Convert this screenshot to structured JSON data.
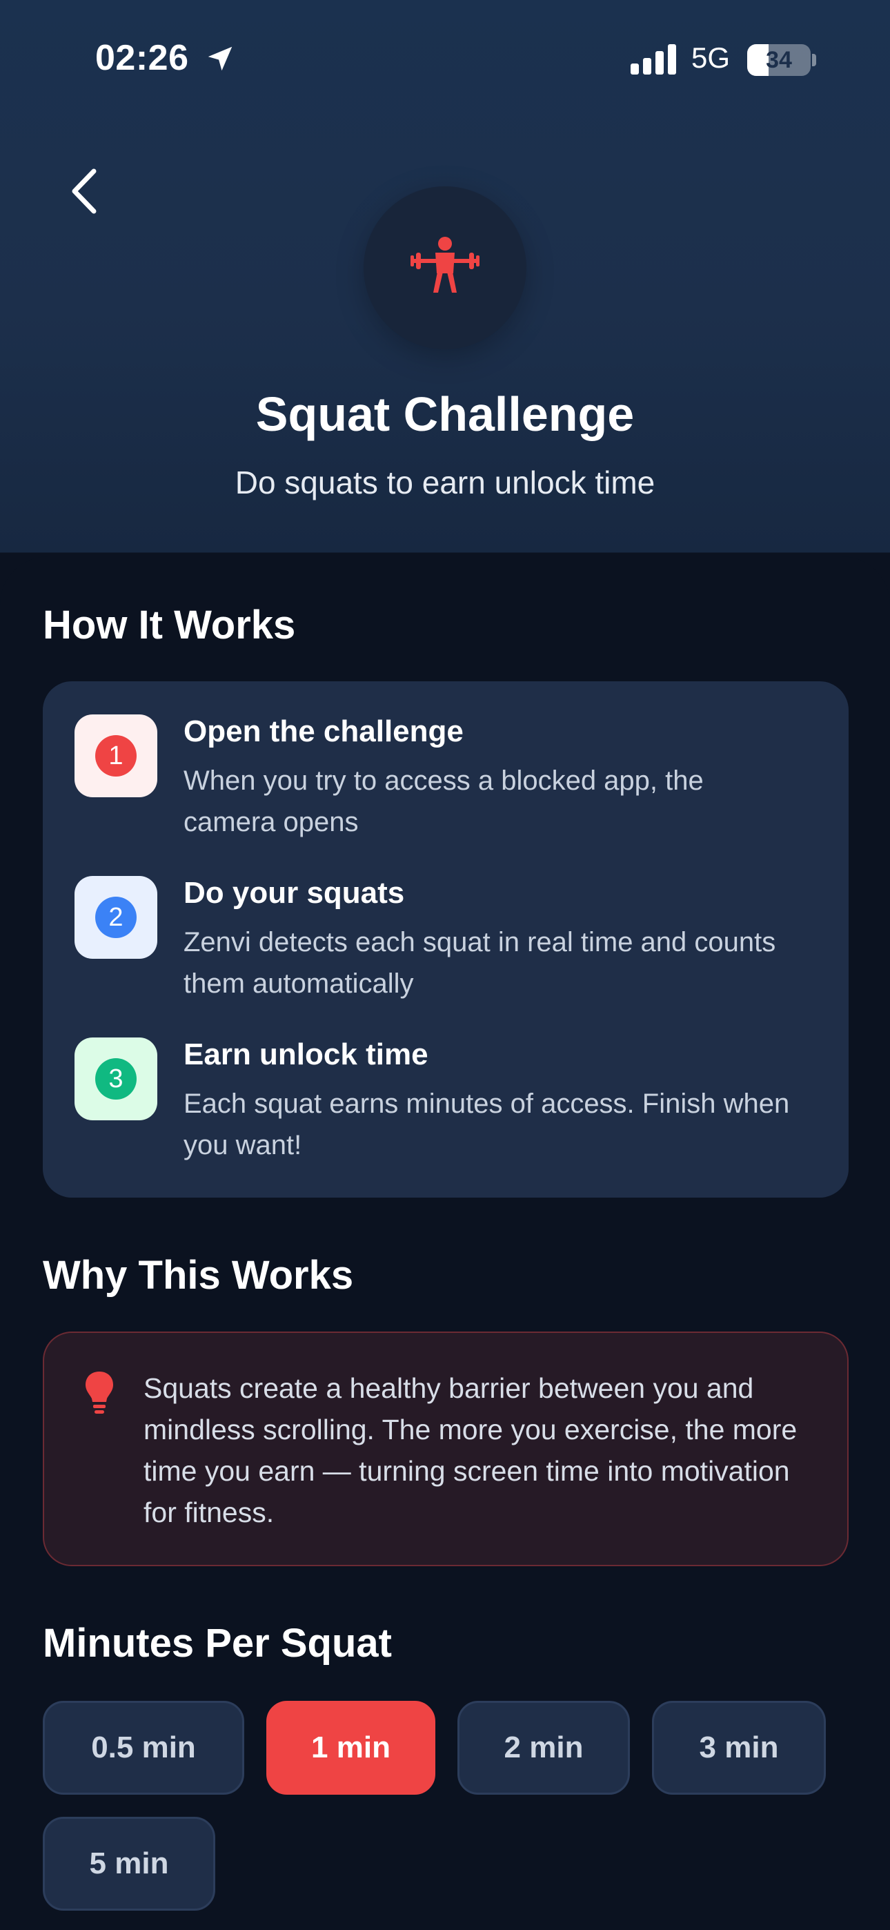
{
  "status_bar": {
    "time": "02:26",
    "network": "5G",
    "battery": "34",
    "battery_level": 0.34
  },
  "header": {
    "title": "Squat Challenge",
    "subtitle": "Do squats to earn unlock time",
    "hero_icon": "weightlifter-icon",
    "accent_color": "#ef4444"
  },
  "how_it_works": {
    "title": "How It Works",
    "steps": [
      {
        "number": "1",
        "title": "Open the challenge",
        "description": "When you try to access a blocked app, the camera opens",
        "color": "#ef4444",
        "badge_bg": "#fef0f0"
      },
      {
        "number": "2",
        "title": "Do your squats",
        "description": "Zenvi detects each squat in real time and counts them automatically",
        "color": "#3b82f6",
        "badge_bg": "#e8f0fe"
      },
      {
        "number": "3",
        "title": "Earn unlock time",
        "description": "Each squat earns minutes of access. Finish when you want!",
        "color": "#10b981",
        "badge_bg": "#dcfce7"
      }
    ]
  },
  "why_this_works": {
    "title": "Why This Works",
    "icon": "lightbulb-icon",
    "text": "Squats create a healthy barrier between you and mindless scrolling. The more you exercise, the more time you earn — turning screen time into motivation for fitness."
  },
  "minutes_per_squat": {
    "title": "Minutes Per Squat",
    "options": [
      "0.5 min",
      "1 min",
      "2 min",
      "3 min",
      "5 min"
    ],
    "selected": "1 min"
  }
}
